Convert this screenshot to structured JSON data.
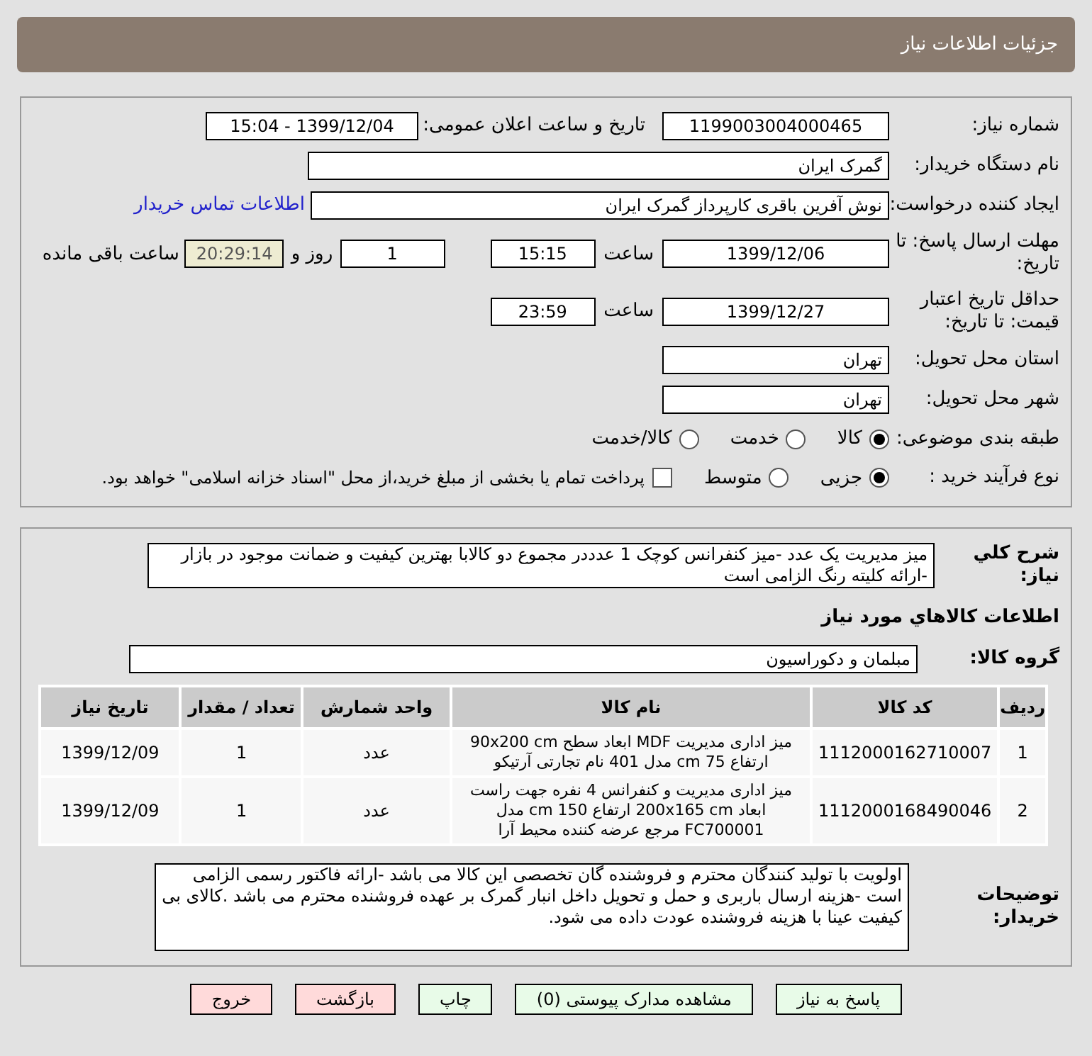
{
  "header": {
    "title": "جزئیات اطلاعات نیاز"
  },
  "need_number": {
    "label": "شماره نیاز:",
    "value": "1199003004000465"
  },
  "announce": {
    "label": "تاریخ و ساعت اعلان عمومی:",
    "value": "1399/12/04 - 15:04"
  },
  "buyer_org": {
    "label": "نام دستگاه خریدار:",
    "value": "گمرک ایران"
  },
  "requester": {
    "label": "ایجاد کننده درخواست:",
    "value": "نوش آفرین باقری کارپرداز گمرک ایران",
    "link": "اطلاعات تماس خریدار"
  },
  "deadline": {
    "label": "مهلت ارسال پاسخ: تا تاریخ:",
    "date": "1399/12/06",
    "time_label": "ساعت",
    "time": "15:15",
    "days": "1",
    "days_label": "روز و",
    "remaining": "20:29:14",
    "remaining_label": "ساعت باقی مانده"
  },
  "validity": {
    "label": "حداقل تاریخ اعتبار قیمت: تا تاریخ:",
    "date": "1399/12/27",
    "time_label": "ساعت",
    "time": "23:59"
  },
  "province": {
    "label": "استان محل تحویل:",
    "value": "تهران"
  },
  "city": {
    "label": "شهر محل تحویل:",
    "value": "تهران"
  },
  "category": {
    "label": "طبقه بندی موضوعی:",
    "options": [
      {
        "label": "کالا",
        "selected": true
      },
      {
        "label": "خدمت",
        "selected": false
      },
      {
        "label": "کالا/خدمت",
        "selected": false
      }
    ]
  },
  "process": {
    "label": "نوع فرآیند خرید :",
    "options": [
      {
        "label": "جزیی",
        "selected": true
      },
      {
        "label": "متوسط",
        "selected": false
      }
    ],
    "payment": {
      "label": "پرداخت تمام یا بخشی از مبلغ خرید،از محل \"اسناد خزانه اسلامی\" خواهد بود.",
      "checked": false
    }
  },
  "description": {
    "label": "شرح کلي نياز:",
    "value": "میز مدیریت یک عدد -میز کنفرانس کوچک 1 عدددر مجموع دو کالابا بهترین کیفیت و ضمانت موجود در بازار -ارائه کلیته رنگ الزامی است"
  },
  "goods_title": "اطلاعات کالاهاي مورد نياز",
  "goods_group": {
    "label": "گروه کالا:",
    "value": "مبلمان و دکوراسیون"
  },
  "table": {
    "columns": [
      "ردیف",
      "کد کالا",
      "نام کالا",
      "واحد شمارش",
      "تعداد / مقدار",
      "تاریخ نیاز"
    ],
    "rows": [
      [
        "1",
        "1112000162710007",
        "میز اداری مدیریت MDF ابعاد سطح 90x200 cm ارتفاع 75 cm مدل 401 نام تجارتی آرتیکو",
        "عدد",
        "1",
        "1399/12/09"
      ],
      [
        "2",
        "1112000168490046",
        "میز اداری مدیریت و کنفرانس 4 نفره جهت راست ابعاد 200x165 cm ارتفاع 150 cm مدل FC700001 مرجع عرضه کننده محیط آرا",
        "عدد",
        "1",
        "1399/12/09"
      ]
    ]
  },
  "buyer_notes": {
    "label": "توضیحات خریدار:",
    "value": "اولویت با تولید کنندگان محترم و فروشنده گان تخصصی این کالا می باشد -ارائه فاکتور رسمی الزامی است -هزینه ارسال باربری و حمل و تحویل داخل انبار گمرک بر عهده فروشنده محترم می باشد .کالای بی کیفیت عینا با هزینه فروشنده عودت داده می شود."
  },
  "buttons": [
    {
      "label": "پاسخ به نیاز",
      "kind": "go"
    },
    {
      "label": "مشاهده مدارک پیوستی (0)",
      "kind": "go"
    },
    {
      "label": "چاپ",
      "kind": "go"
    },
    {
      "label": "بازگشت",
      "kind": "stop"
    },
    {
      "label": "خروج",
      "kind": "stop"
    }
  ]
}
